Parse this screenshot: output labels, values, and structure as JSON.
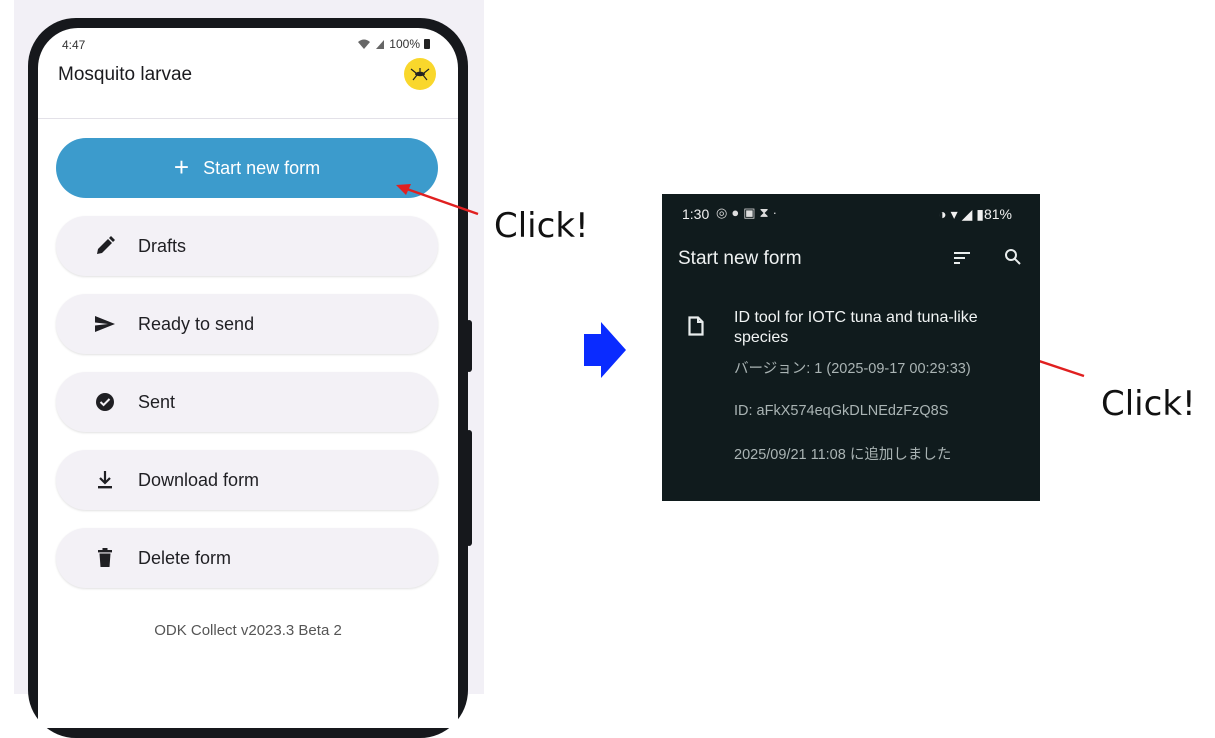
{
  "left_phone": {
    "status": {
      "time": "4:47",
      "indicators": "100%"
    },
    "app_title": "Mosquito larvae",
    "avatar_icon": "mosquito-icon",
    "primary_button": {
      "label": "Start new form",
      "icon": "plus-icon",
      "color": "#3c9bcc"
    },
    "menu": [
      {
        "label": "Drafts",
        "icon": "pencil-icon"
      },
      {
        "label": "Ready to send",
        "icon": "send-icon"
      },
      {
        "label": "Sent",
        "icon": "check-circle-icon"
      },
      {
        "label": "Download form",
        "icon": "download-icon"
      },
      {
        "label": "Delete form",
        "icon": "trash-icon"
      }
    ],
    "version": "ODK Collect v2023.3 Beta 2"
  },
  "annotations": {
    "click_left": "Click!",
    "click_right": "Click!",
    "arrow_color": "#e02020",
    "next_arrow_color": "#0a2bff"
  },
  "right_screen": {
    "status": {
      "time": "1:30",
      "battery": "81%"
    },
    "title": "Start new form",
    "form": {
      "title": "ID tool for IOTC tuna and tuna-like species",
      "version": "バージョン: 1 (2025-09-17 00:29:33)",
      "id": "ID: aFkX574eqGkDLNEdzFzQ8S",
      "added": "2025/09/21 11:08 に追加しました"
    },
    "background": "#101b1d"
  }
}
